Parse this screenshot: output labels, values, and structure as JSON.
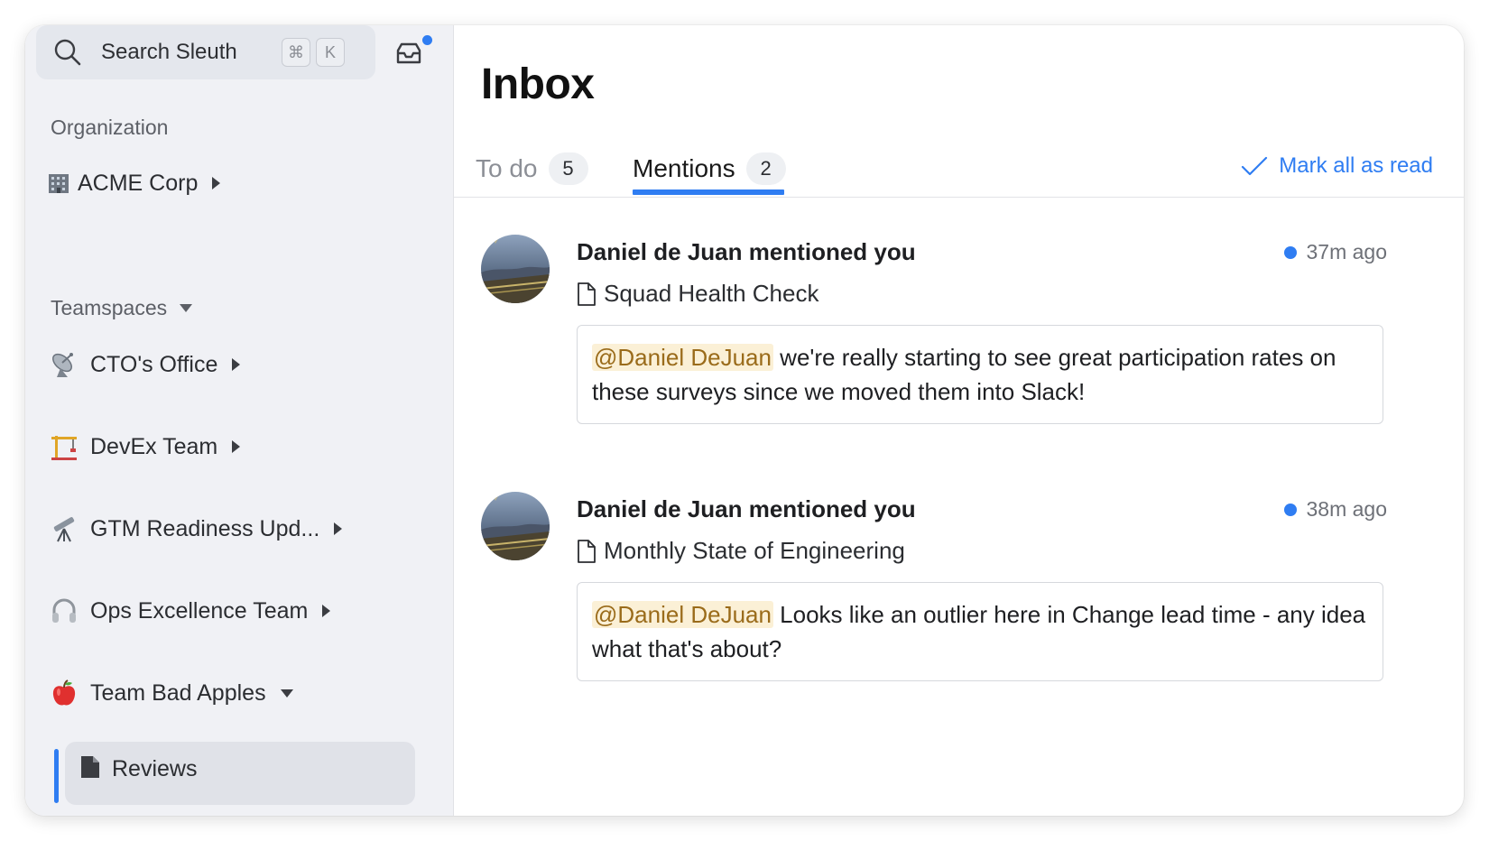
{
  "search": {
    "label": "Search Sleuth",
    "shortcut_cmd": "⌘",
    "shortcut_key": "K"
  },
  "sidebar": {
    "organization_label": "Organization",
    "org": {
      "label": "ACME Corp",
      "icon": "office-building-icon"
    },
    "teamspaces_label": "Teamspaces",
    "items": [
      {
        "label": "CTO's Office",
        "icon": "satellite-dish-icon",
        "expand": "collapsed"
      },
      {
        "label": "DevEx Team",
        "icon": "construction-crane-icon",
        "expand": "collapsed"
      },
      {
        "label": "GTM Readiness Upd...",
        "icon": "telescope-icon",
        "expand": "collapsed"
      },
      {
        "label": "Ops Excellence Team",
        "icon": "headphones-icon",
        "expand": "collapsed"
      },
      {
        "label": "Team Bad Apples",
        "icon": "red-apple-icon",
        "expand": "expanded"
      }
    ],
    "sub_item": {
      "label": "Reviews",
      "icon": "document-icon"
    }
  },
  "main": {
    "title": "Inbox",
    "tabs": [
      {
        "label": "To do",
        "count": "5",
        "active": false
      },
      {
        "label": "Mentions",
        "count": "2",
        "active": true
      }
    ],
    "mark_all_read": "Mark all as read",
    "mentions": [
      {
        "title": "Daniel de Juan mentioned you",
        "time": "37m ago",
        "doc": "Squad Health Check",
        "mention_tag": "@Daniel DeJuan",
        "message": " we're really starting to see great participation rates on these surveys since we moved them into Slack!"
      },
      {
        "title": "Daniel de Juan mentioned you",
        "time": "38m ago",
        "doc": "Monthly State of Engineering",
        "mention_tag": "@Daniel DeJuan",
        "message": " Looks like an outlier here in Change lead time - any idea what that's about?"
      }
    ]
  },
  "colors": {
    "accent": "#2f7df2",
    "sidebar_bg": "#f0f1f5",
    "mention_bg": "#fbf0d6",
    "mention_fg": "#9a6b1a"
  }
}
